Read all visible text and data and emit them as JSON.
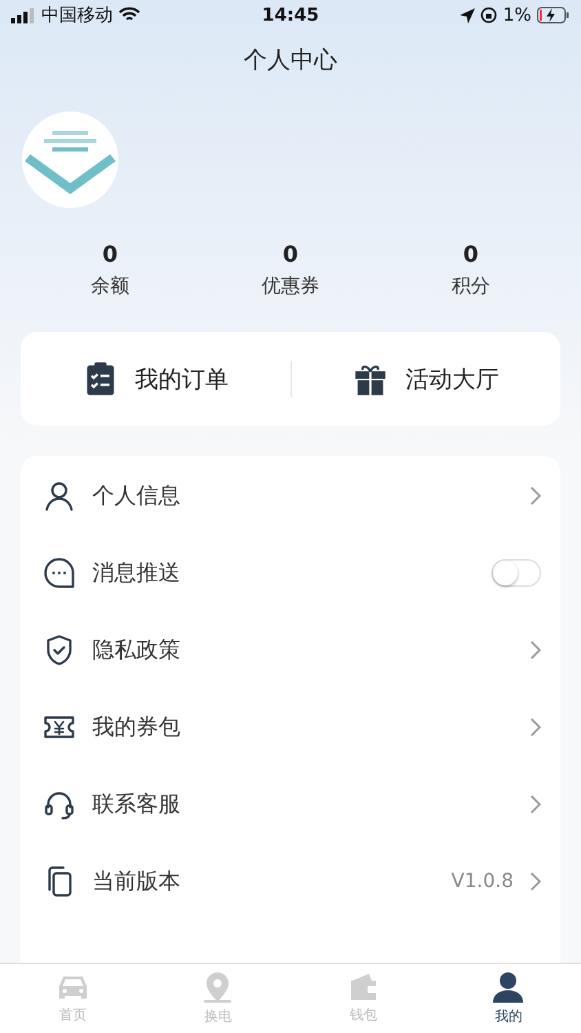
{
  "status_bar": {
    "carrier": "中国移动",
    "time": "14:45",
    "battery": "1%"
  },
  "title": "个人中心",
  "stats": [
    {
      "value": "0",
      "label": "余额"
    },
    {
      "value": "0",
      "label": "优惠券"
    },
    {
      "value": "0",
      "label": "积分"
    }
  ],
  "shortcuts": [
    {
      "label": "我的订单"
    },
    {
      "label": "活动大厅"
    }
  ],
  "menu": [
    {
      "label": "个人信息",
      "kind": "link"
    },
    {
      "label": "消息推送",
      "kind": "toggle",
      "on": false
    },
    {
      "label": "隐私政策",
      "kind": "link"
    },
    {
      "label": "我的券包",
      "kind": "link"
    },
    {
      "label": "联系客服",
      "kind": "link"
    },
    {
      "label": "当前版本",
      "kind": "link",
      "value": "V1.0.8"
    }
  ],
  "tabs": [
    {
      "label": "首页",
      "selected": false
    },
    {
      "label": "换电",
      "selected": false
    },
    {
      "label": "钱包",
      "selected": false
    },
    {
      "label": "我的",
      "selected": true
    }
  ]
}
